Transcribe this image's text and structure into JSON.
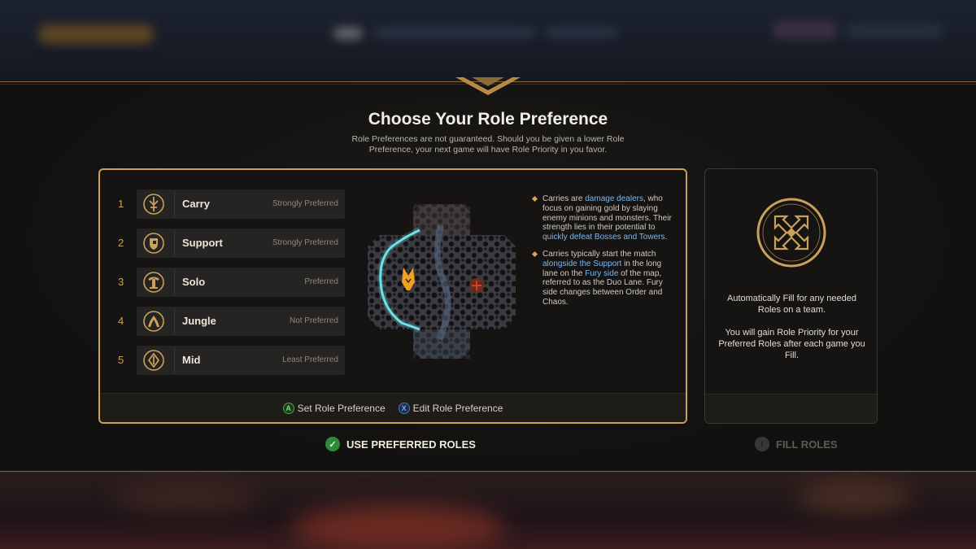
{
  "modal": {
    "title": "Choose Your Role Preference",
    "subtitle": "Role Preferences are not guaranteed. Should you be given a lower Role Preference, your next game will have Role Priority in you favor."
  },
  "roles": [
    {
      "rank": "1",
      "name": "Carry",
      "preference": "Strongly Preferred",
      "icon": "carry-icon"
    },
    {
      "rank": "2",
      "name": "Support",
      "preference": "Strongly Preferred",
      "icon": "support-icon"
    },
    {
      "rank": "3",
      "name": "Solo",
      "preference": "Preferred",
      "icon": "solo-icon"
    },
    {
      "rank": "4",
      "name": "Jungle",
      "preference": "Not Preferred",
      "icon": "jungle-icon"
    },
    {
      "rank": "5",
      "name": "Mid",
      "preference": "Least Preferred",
      "icon": "mid-icon"
    }
  ],
  "description": {
    "p1": {
      "t1": "Carries are ",
      "h1": "damage dealers",
      "t2": ", who focus on gaining gold by slaying enemy minions and monsters. Their strength lies in their potential to ",
      "h2": "quickly defeat Bosses and Towers",
      "t3": "."
    },
    "p2": {
      "t1": "Carries typically start the match ",
      "h1": "alongside the Support",
      "t2": " in the long lane on the ",
      "h2": "Fury side",
      "t3": " of the map, referred to as the Duo Lane. Fury side changes between Order and Chaos."
    }
  },
  "footer": {
    "set_label": "Set Role Preference",
    "set_glyph": "A",
    "edit_label": "Edit Role Preference",
    "edit_glyph": "X"
  },
  "fill_panel": {
    "text1": "Automatically Fill for any needed Roles on a team.",
    "text2": "You will gain Role Priority for your Preferred Roles after each game you Fill."
  },
  "actions": {
    "use_preferred": "USE PREFERRED ROLES",
    "fill_roles": "FILL ROLES"
  },
  "colors": {
    "accent_gold": "#c9a15a",
    "highlight_blue": "#7cb8ef",
    "confirm_green": "#2d8a3b"
  }
}
